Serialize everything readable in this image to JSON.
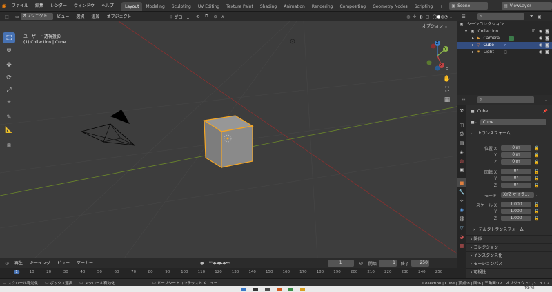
{
  "topbar": {
    "menus": [
      "ファイル",
      "編集",
      "レンダー",
      "ウィンドウ",
      "ヘルプ"
    ],
    "workspaces": [
      "Layout",
      "Modeling",
      "Sculpting",
      "UV Editing",
      "Texture Paint",
      "Shading",
      "Animation",
      "Rendering",
      "Compositing",
      "Geometry Nodes",
      "Scripting"
    ],
    "active_workspace": "Layout",
    "add_tab": "+",
    "scene": "Scene",
    "view_layer": "ViewLayer"
  },
  "viewport_header": {
    "mode": "オブジェクト...",
    "menus": [
      "ビュー",
      "選択",
      "追加",
      "オブジェクト"
    ],
    "orientation": "グロー...",
    "options": "オプション"
  },
  "viewport": {
    "view_name": "ユーザー・透視投影",
    "collection_info": "(1) Collection | Cube",
    "gizmo": {
      "y": "Y",
      "x": "X",
      "z": "Z"
    }
  },
  "timeline_header": {
    "menus": [
      "再生",
      "キーイング",
      "ビュー",
      "マーカー"
    ],
    "current_frame": "1",
    "start_label": "開始",
    "start": "1",
    "end_label": "終了",
    "end": "250"
  },
  "timeline": {
    "ticks": [
      "1",
      "10",
      "20",
      "30",
      "40",
      "50",
      "60",
      "70",
      "80",
      "90",
      "100",
      "110",
      "120",
      "130",
      "140",
      "150",
      "160",
      "170",
      "180",
      "190",
      "200",
      "210",
      "220",
      "230",
      "240",
      "250"
    ]
  },
  "statusbar": {
    "left": [
      "スクロール有効化",
      "ボックス選択",
      "スクロール有効化"
    ],
    "center": "ドープシートコンテクストメニュー",
    "right": "Collection | Cube | 頂点:8 | 面:6 | 三角面:12 | オブジェクト:1/3 | 3.1.2"
  },
  "taskbar": {
    "time": "19:20"
  },
  "outliner": {
    "scene_collection": "シーンコレクション",
    "collection": "Collection",
    "items": [
      {
        "name": "Camera",
        "selected": false,
        "color": "#e0a040"
      },
      {
        "name": "Cube",
        "selected": true,
        "color": "#e08040"
      },
      {
        "name": "Light",
        "selected": false,
        "color": "#e0a040"
      }
    ]
  },
  "properties": {
    "object_name": "Cube",
    "name_field": "Cube",
    "transform_title": "トランスフォーム",
    "location_label": "位置 X",
    "location": [
      "0 m",
      "0 m",
      "0 m"
    ],
    "rotation_label": "回転 X",
    "rotation": [
      "0°",
      "0°",
      "0°"
    ],
    "mode_label": "モード",
    "mode_value": "XYZ オイラ...",
    "scale_label": "スケール X",
    "scale": [
      "1.000",
      "1.000",
      "1.000"
    ],
    "axis_y": "Y",
    "axis_z": "Z",
    "delta_transform": "デルタトランスフォーム",
    "panels": [
      "関係",
      "コレクション",
      "インスタンス化",
      "モーションパス",
      "可視性"
    ]
  },
  "colors": {
    "accent": "#4772b3",
    "selection_outline": "#f5a623",
    "x_axis": "#8a3030",
    "y_axis": "#6d8a2a"
  }
}
